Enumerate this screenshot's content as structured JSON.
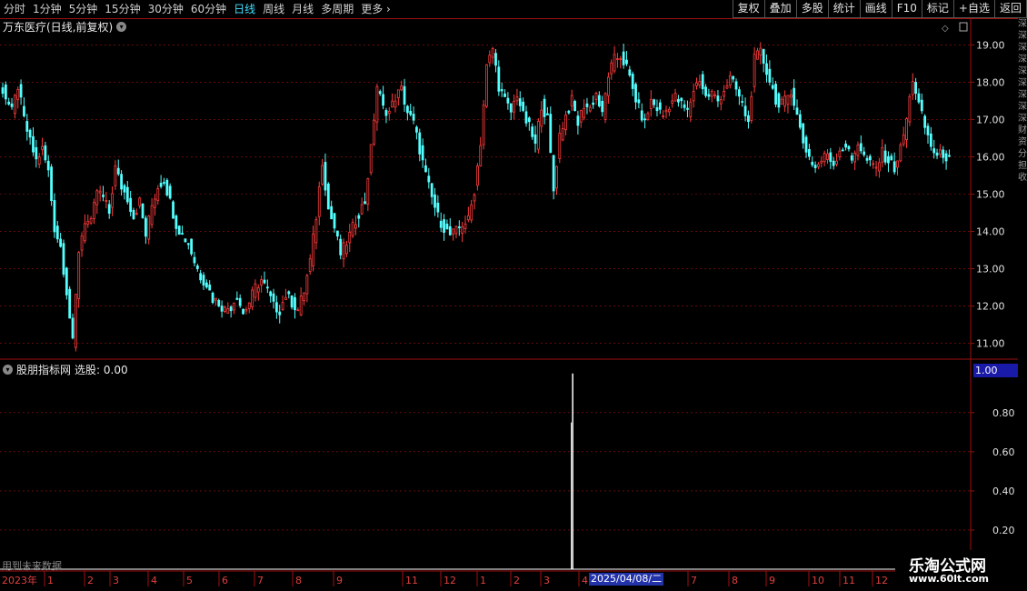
{
  "toolbar": {
    "periods": [
      "分时",
      "1分钟",
      "5分钟",
      "15分钟",
      "30分钟",
      "60分钟",
      "日线",
      "周线",
      "月线",
      "多周期",
      "更多 ›"
    ],
    "active_index": 6,
    "buttons": [
      "复权",
      "叠加",
      "多股",
      "统计",
      "画线",
      "F10",
      "标记",
      "+自选",
      "返回"
    ]
  },
  "main_chart": {
    "title": "万东医疗(日线,前复权)",
    "y_ticks": [
      "19.00",
      "18.00",
      "17.00",
      "16.00",
      "15.00",
      "14.00",
      "13.00",
      "12.00",
      "11.00"
    ]
  },
  "indicator": {
    "title": "股朋指标网",
    "selection_label": "选股: 0.00",
    "current_value": "1.00",
    "y_ticks": [
      "0.80",
      "0.60",
      "0.40",
      "0.20"
    ],
    "notice": "用到未来数据"
  },
  "x_axis": {
    "year_label": "2023年",
    "month_labels": [
      "1",
      "2",
      "3",
      "4",
      "5",
      "6",
      "7",
      "8",
      "9",
      "10",
      "11",
      "12",
      "1",
      "2",
      "3",
      "4",
      "7",
      "8",
      "9",
      "10",
      "11",
      "12"
    ],
    "highlight_date": "2025/04/08/二"
  },
  "watermark": {
    "name": "乐淘公式网",
    "url": "www.60lt.com"
  },
  "colors": {
    "up": "#ff3c3c",
    "down": "#54ffff",
    "axis": "#a01010",
    "signal": "#ffffff"
  },
  "chart_data": {
    "type": "candlestick",
    "series": [
      {
        "name": "",
        "close": [
          18.0,
          17.6,
          17.2,
          17.9,
          17.0,
          16.4,
          15.9,
          16.2,
          15.6,
          14.1,
          13.6,
          12.4,
          11.0,
          13.5,
          14.3,
          14.2,
          15.1,
          14.9,
          14.5,
          15.7,
          15.2,
          14.9,
          14.4,
          14.8,
          13.9,
          14.7,
          15.2,
          15.4,
          14.8,
          14.2,
          13.9,
          13.7,
          13.2,
          12.8,
          12.6,
          12.2,
          12.1,
          11.9,
          12.0,
          12.3,
          11.8,
          12.1,
          12.5,
          12.7,
          12.4,
          12.0,
          11.9,
          12.3,
          12.1,
          11.9,
          12.4,
          13.2,
          14.4,
          15.9,
          14.6,
          14.1,
          13.4,
          13.7,
          14.1,
          14.5,
          14.8,
          16.2,
          17.9,
          17.3,
          17.2,
          17.6,
          17.8,
          17.2,
          16.9,
          16.2,
          15.5,
          14.9,
          14.4,
          14.1,
          13.9,
          14.0,
          14.2,
          14.3,
          15.1,
          16.4,
          18.4,
          18.9,
          17.9,
          17.5,
          17.2,
          17.7,
          17.1,
          16.8,
          16.3,
          17.4,
          17.0,
          15.1,
          16.6,
          17.1,
          17.5,
          16.9,
          17.4,
          17.3,
          17.7,
          17.1,
          18.2,
          18.6,
          18.7,
          18.4,
          17.8,
          17.3,
          16.9,
          17.5,
          17.3,
          17.1,
          17.4,
          17.6,
          17.4,
          17.2,
          17.8,
          18.1,
          17.6,
          17.7,
          17.5,
          17.8,
          18.1,
          17.8,
          17.4,
          16.9,
          18.6,
          18.8,
          18.3,
          17.8,
          17.3,
          17.5,
          17.8,
          17.1,
          16.4,
          16.0,
          15.7,
          15.9,
          16.1,
          15.8,
          16.2,
          16.3,
          15.9,
          16.4,
          16.0,
          15.8,
          15.7,
          16.1,
          15.9,
          15.7,
          16.2,
          17.0,
          18.1,
          17.4,
          16.8,
          16.3,
          16.0,
          16.1,
          15.9
        ]
      }
    ],
    "ylim": [
      10.7,
      19.3
    ],
    "signal": {
      "name": "",
      "index": 0.59,
      "value": 1.0
    },
    "indicator_ylim": [
      0,
      1.05
    ]
  }
}
